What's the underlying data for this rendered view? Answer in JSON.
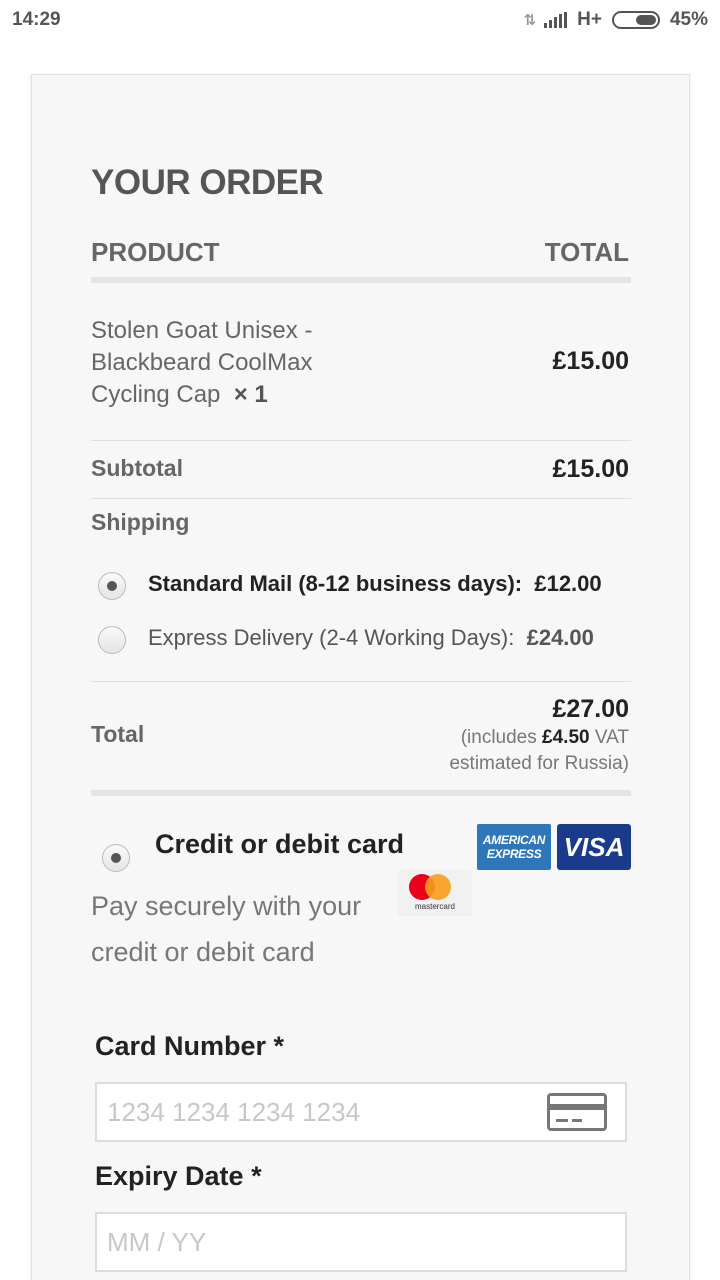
{
  "status_bar": {
    "time": "14:29",
    "network": "H+",
    "battery": "45%"
  },
  "order": {
    "title": "YOUR ORDER",
    "col_product": "PRODUCT",
    "col_total": "TOTAL",
    "item": {
      "name": "Stolen Goat Unisex - Blackbeard CoolMax Cycling Cap",
      "qty": "× 1",
      "price": "£15.00"
    },
    "subtotal_label": "Subtotal",
    "subtotal_value": "£15.00",
    "shipping_label": "Shipping",
    "shipping_options": [
      {
        "label": "Standard Mail (8-12 business days):",
        "price": "£12.00",
        "selected": true
      },
      {
        "label": "Express Delivery (2-4 Working Days):",
        "price": "£24.00",
        "selected": false
      }
    ],
    "total_label": "Total",
    "total_value": "£27.00",
    "vat_prefix": "(includes",
    "vat_amount": "£4.50",
    "vat_suffix": "VAT estimated for Russia)"
  },
  "payment": {
    "method_title": "Credit or debit card",
    "description": "Pay securely with your credit or debit card",
    "logos": {
      "amex": "AMERICAN EXPRESS",
      "visa": "VISA",
      "mastercard": "mastercard"
    },
    "card_number_label": "Card Number *",
    "card_number_placeholder": "1234 1234 1234 1234",
    "expiry_label": "Expiry Date *",
    "expiry_placeholder": "MM / YY"
  },
  "colors": {
    "amex": "#2e77bb",
    "visa": "#1a3a8c",
    "mastercard_red": "#eb001b",
    "mastercard_yellow": "#f79e1b"
  }
}
